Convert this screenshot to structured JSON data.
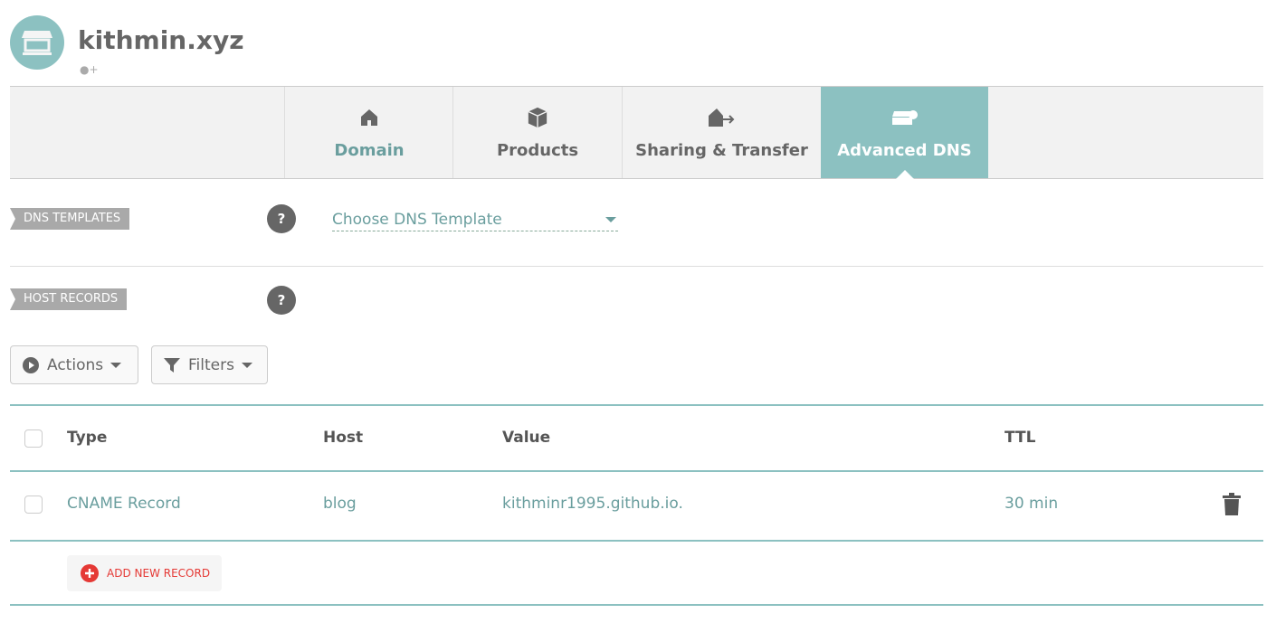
{
  "domain": {
    "name": "kithmin.xyz"
  },
  "tabs": [
    {
      "label": "Domain",
      "icon": "home-icon"
    },
    {
      "label": "Products",
      "icon": "box-icon"
    },
    {
      "label": "Sharing & Transfer",
      "icon": "house-arrow-icon"
    },
    {
      "label": "Advanced DNS",
      "icon": "server-gear-icon"
    }
  ],
  "dns_templates": {
    "label": "DNS TEMPLATES",
    "help": "?",
    "select": "Choose DNS Template"
  },
  "host_records": {
    "label": "HOST RECORDS",
    "help": "?",
    "actions": "Actions",
    "filters": "Filters",
    "columns": {
      "type": "Type",
      "host": "Host",
      "value": "Value",
      "ttl": "TTL"
    },
    "rows": [
      {
        "type": "CNAME Record",
        "host": "blog",
        "value": "kithminr1995.github.io.",
        "ttl": "30 min"
      }
    ],
    "add": "ADD NEW RECORD"
  },
  "colors": {
    "accent": "#8cc1c1",
    "danger": "#e53935"
  }
}
